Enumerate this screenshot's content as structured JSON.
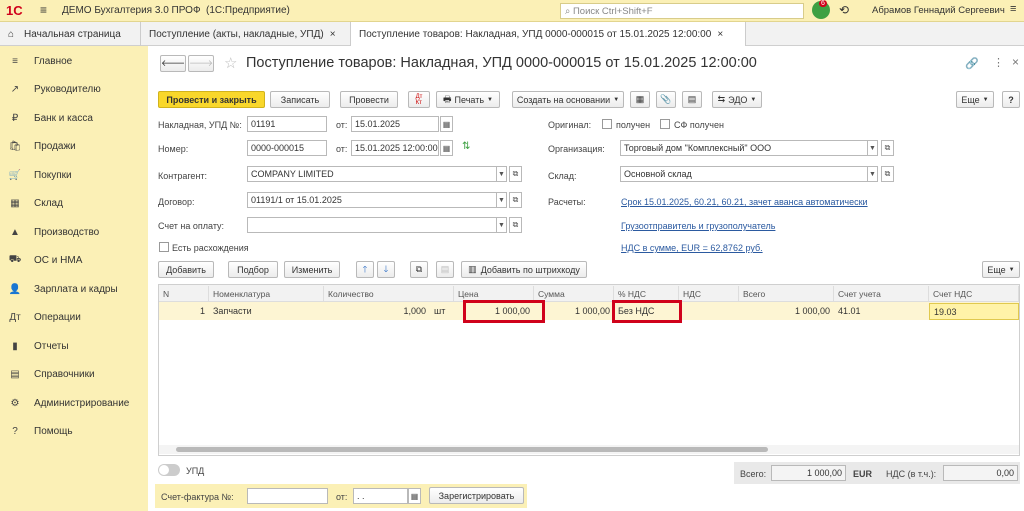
{
  "app": {
    "logo": "1С",
    "title": "ДЕМО Бухгалтерия 3.0 ПРОФ",
    "platform": "(1С:Предприятие)",
    "search_placeholder": "Поиск Ctrl+Shift+F",
    "notif_count": "6",
    "user": "Абрамов Геннадий Сергеевич"
  },
  "tabs": {
    "home": "Начальная страница",
    "t1": "Поступление (акты, накладные, УПД)",
    "t2": "Поступление товаров: Накладная, УПД 0000-000015 от 15.01.2025 12:00:00"
  },
  "sidebar": [
    {
      "icon": "≡",
      "label": "Главное"
    },
    {
      "icon": "↗",
      "label": "Руководителю"
    },
    {
      "icon": "₽",
      "label": "Банк и касса"
    },
    {
      "icon": "🛍",
      "label": "Продажи"
    },
    {
      "icon": "🛒",
      "label": "Покупки"
    },
    {
      "icon": "▦",
      "label": "Склад"
    },
    {
      "icon": "▲",
      "label": "Производство"
    },
    {
      "icon": "⛟",
      "label": "ОС и НМА"
    },
    {
      "icon": "👤",
      "label": "Зарплата и кадры"
    },
    {
      "icon": "Дт",
      "label": "Операции"
    },
    {
      "icon": "▮",
      "label": "Отчеты"
    },
    {
      "icon": "▤",
      "label": "Справочники"
    },
    {
      "icon": "⚙",
      "label": "Администрирование"
    },
    {
      "icon": "?",
      "label": "Помощь"
    }
  ],
  "doc": {
    "title": "Поступление товаров: Накладная, УПД 0000-000015 от 15.01.2025 12:00:00"
  },
  "toolbar": {
    "post_close": "Провести и закрыть",
    "save": "Записать",
    "post": "Провести",
    "print": "Печать",
    "create_based": "Создать на основании",
    "edo": "ЭДО",
    "more": "Еще",
    "help": "?"
  },
  "form": {
    "invoice_no_label": "Накладная, УПД №:",
    "invoice_no": "01191",
    "from_label": "от:",
    "invoice_date": "15.01.2025",
    "number_label": "Номер:",
    "number": "0000-000015",
    "doc_date": "15.01.2025 12:00:00",
    "counterparty_label": "Контрагент:",
    "counterparty": "COMPANY LIMITED",
    "contract_label": "Договор:",
    "contract": "01191/1 от 15.01.2025",
    "pay_account_label": "Счет на оплату:",
    "pay_account": "",
    "discrepancy_label": "Есть расхождения",
    "original_label": "Оригинал:",
    "received_label": "получен",
    "sf_received_label": "СФ получен",
    "org_label": "Организация:",
    "org": "Торговый дом \"Комплексный\" ООО",
    "warehouse_label": "Склад:",
    "warehouse": "Основной склад",
    "settlements_label": "Расчеты:",
    "settlements_link": "Срок 15.01.2025, 60.21, 60.21, зачет аванса автоматически",
    "shipper_link": "Грузоотправитель и грузополучатель",
    "vat_link": "НДС в сумме, EUR = 62,8762 руб."
  },
  "table_toolbar": {
    "add": "Добавить",
    "select": "Подбор",
    "edit": "Изменить",
    "barcode": "Добавить по штрихкоду",
    "more": "Еще"
  },
  "table": {
    "headers": [
      "N",
      "Номенклатура",
      "Количество",
      "Цена",
      "Сумма",
      "% НДС",
      "НДС",
      "Всего",
      "Счет учета",
      "Счет НДС"
    ],
    "rows": [
      {
        "n": "1",
        "item": "Запчасти",
        "qty": "1,000",
        "unit": "шт",
        "price": "1 000,00",
        "sum": "1 000,00",
        "vat_rate": "Без НДС",
        "vat": "",
        "total": "1 000,00",
        "account": "41.01",
        "vat_account": "19.03"
      }
    ]
  },
  "footer": {
    "upd_label": "УПД",
    "sf_label": "Счет-фактура №:",
    "sf_no": "",
    "from_label": "от:",
    "sf_date": " .  .",
    "register": "Зарегистрировать",
    "total_label": "Всего:",
    "total": "1 000,00",
    "currency": "EUR",
    "vat_label": "НДС (в т.ч.):",
    "vat": "0,00"
  },
  "colors": {
    "accent": "#f9d72b",
    "highlight": "#d0021b",
    "sidebar": "#fbf0b6"
  }
}
